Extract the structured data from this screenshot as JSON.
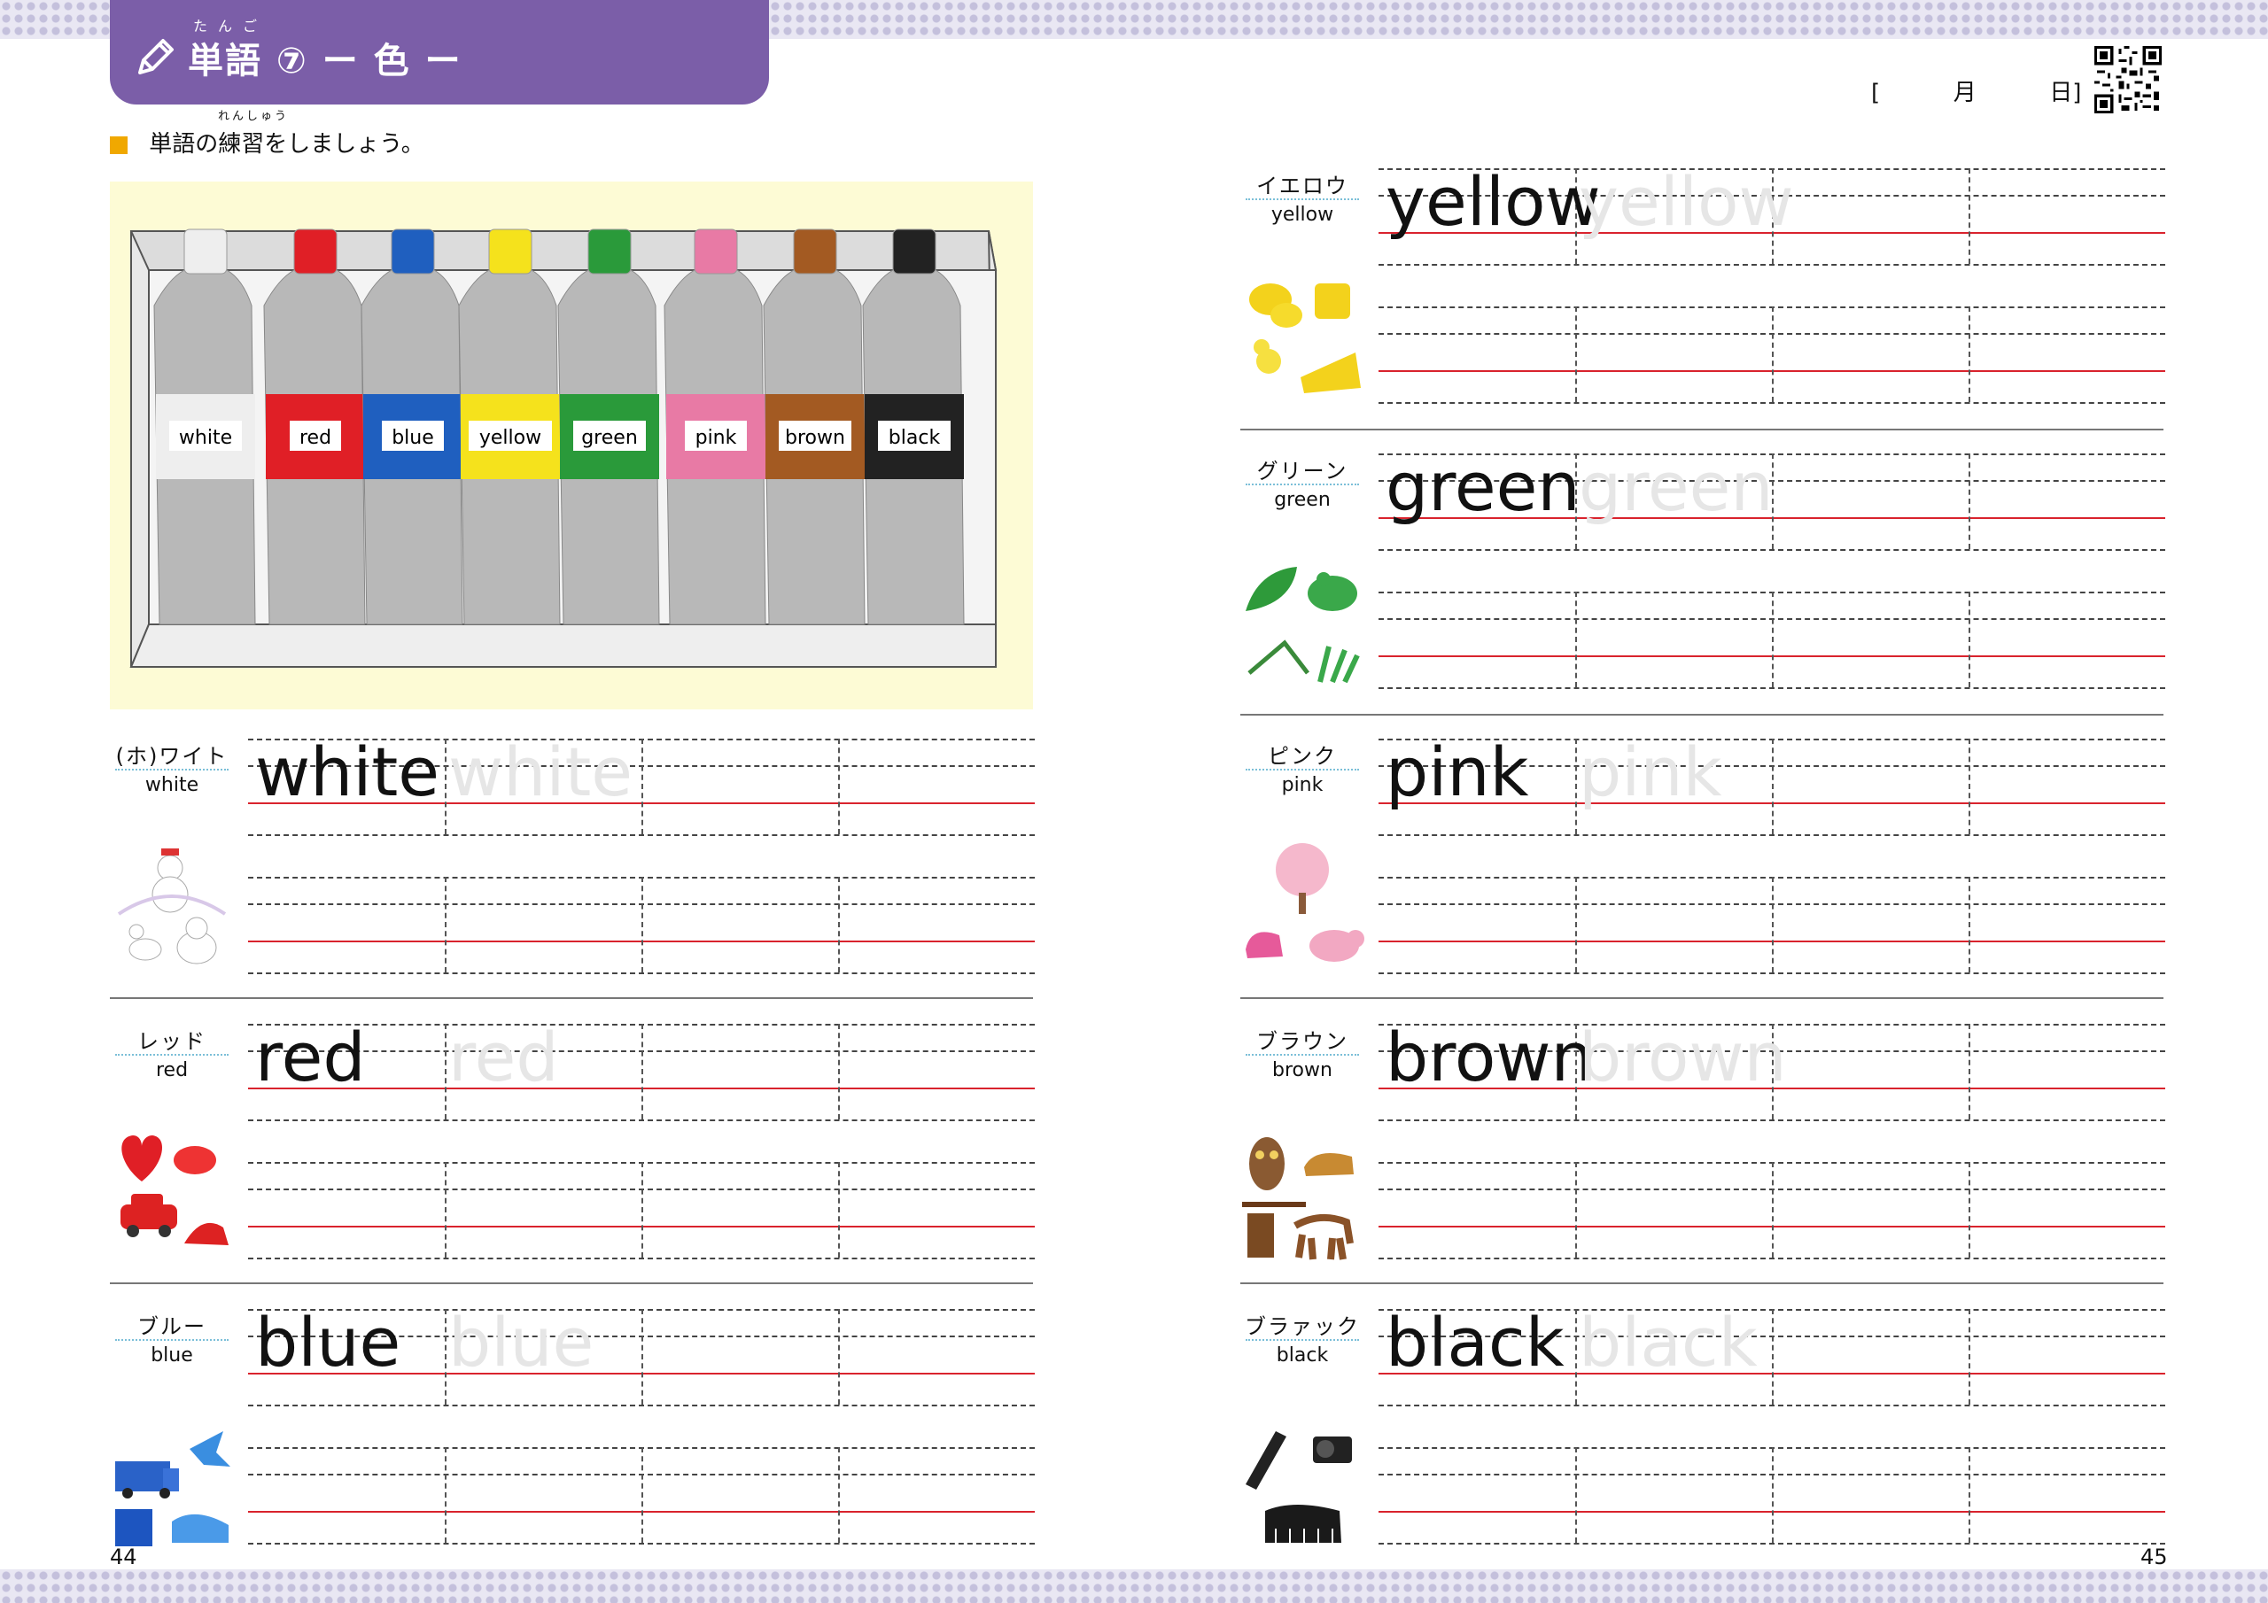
{
  "header": {
    "title": "単語 ⑦ ー 色 ー",
    "title_ruby": "たんご"
  },
  "instruction": {
    "text": "単語の練習をしましょう。",
    "ruby": "れんしゅう"
  },
  "date": {
    "open": "[",
    "month": "月",
    "day": "日]"
  },
  "illustration": {
    "tube_labels": [
      "white",
      "red",
      "blue",
      "yellow",
      "green",
      "pink",
      "brown",
      "black"
    ],
    "tube_colors": [
      "#eeeeee",
      "#e01f26",
      "#1f5fbf",
      "#f5e21c",
      "#2a9a3a",
      "#e87aa5",
      "#a35a22",
      "#222222"
    ]
  },
  "words": [
    {
      "kana": "(ホ)ワイト",
      "english": "white",
      "model": "white",
      "trace": "white"
    },
    {
      "kana": "レッド",
      "english": "red",
      "model": "red",
      "trace": "red"
    },
    {
      "kana": "ブルー",
      "english": "blue",
      "model": "blue",
      "trace": "blue"
    },
    {
      "kana": "イエロウ",
      "english": "yellow",
      "model": "yellow",
      "trace": "yellow"
    },
    {
      "kana": "グリーン",
      "english": "green",
      "model": "green",
      "trace": "green"
    },
    {
      "kana": "ピンク",
      "english": "pink",
      "model": "pink",
      "trace": "pink"
    },
    {
      "kana": "ブラウン",
      "english": "brown",
      "model": "brown",
      "trace": "brown"
    },
    {
      "kana": "ブラァック",
      "english": "black",
      "model": "black",
      "trace": "black"
    }
  ],
  "page_numbers": {
    "left": "44",
    "right": "45"
  }
}
